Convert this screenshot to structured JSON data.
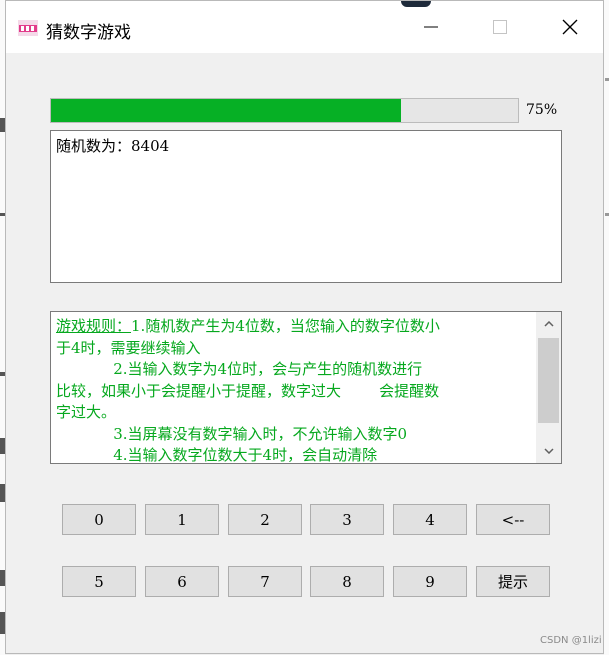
{
  "window": {
    "title": "猜数字游戏",
    "icon": "app-game-icon",
    "controls": [
      "minimize-icon",
      "maximize-icon",
      "close-icon"
    ]
  },
  "progress": {
    "value": 0.75,
    "label": "75%",
    "color": "#06b025"
  },
  "output": {
    "text": "随机数为：8404"
  },
  "rules": {
    "title": "游戏规则：",
    "lines": [
      "1.随机数产生为4位数，当您输入的数字位数小",
      "于4时，需要继续输入",
      "            2.当输入数字为4位时，会与产生的随机数进行",
      "比较，如果小于会提醒小于提醒，数字过大        会提醒数",
      "字过大。",
      "            3.当屏幕没有数字输入时，不允许输入数字0",
      "            4.当输入数字位数大于4时，会自动清除"
    ],
    "color": "#06a81e"
  },
  "keypad": {
    "row1": [
      "0",
      "1",
      "2",
      "3",
      "4",
      "<--"
    ],
    "row2": [
      "5",
      "6",
      "7",
      "8",
      "9",
      "提示"
    ]
  },
  "watermark": "CSDN @1lizi"
}
